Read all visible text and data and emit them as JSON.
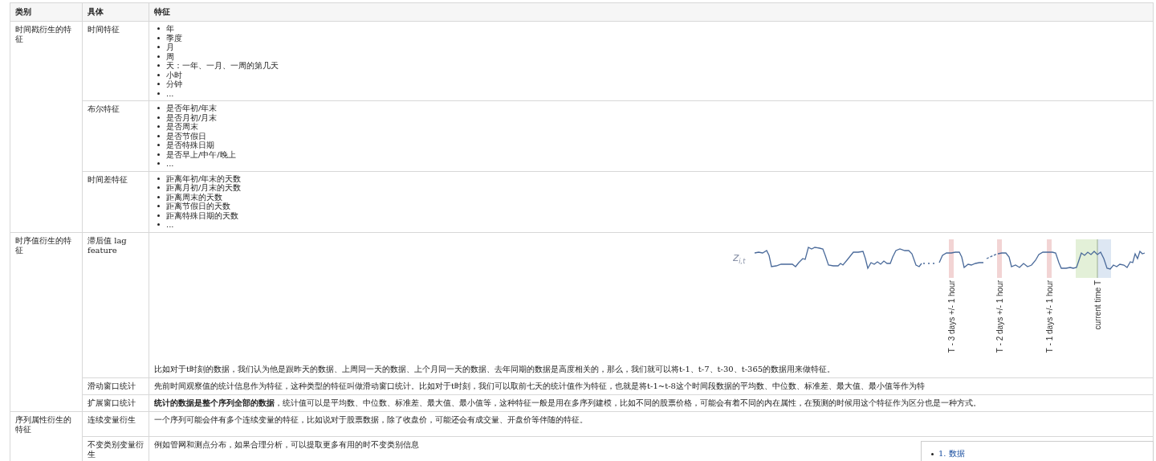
{
  "table": {
    "columns": [
      "类别",
      "具体",
      "特征"
    ],
    "groups": [
      {
        "category": "时间戳衍生的特征",
        "rows": [
          {
            "name": "时间特征",
            "kind": "list",
            "items": [
              "年",
              "季度",
              "月",
              "周",
              "天：一年、一月、一周的第几天",
              "小时",
              "分钟",
              "..."
            ]
          },
          {
            "name": "布尔特征",
            "kind": "list",
            "items": [
              "是否年初/年末",
              "是否月初/月末",
              "是否周末",
              "是否节假日",
              "是否特殊日期",
              "是否早上/中午/晚上",
              "..."
            ]
          },
          {
            "name": "时间差特征",
            "kind": "list",
            "items": [
              "距离年初/年末的天数",
              "距离月初/月末的天数",
              "距离周末的天数",
              "距离节假日的天数",
              "距离特殊日期的天数",
              "..."
            ]
          }
        ]
      },
      {
        "category": "时序值衍生的特征",
        "rows": [
          {
            "name": "滞后值 lag feature",
            "kind": "figure",
            "figure": {
              "symbol": "z",
              "subscript": "i,t",
              "markers": [
                {
                  "label": "T - 3 days +/- 1 hour",
                  "kind": "lag"
                },
                {
                  "label": "T - 2 days +/- 1 hour",
                  "kind": "lag"
                },
                {
                  "label": "T - 1 days +/- 1 hour",
                  "kind": "lag"
                },
                {
                  "label": "current time T",
                  "kind": "current"
                }
              ]
            },
            "text": "比如对于t时刻的数据，我们认为他是跟昨天的数据、上周同一天的数据、上个月同一天的数据、去年同期的数据是高度相关的，那么，我们就可以将t-1、t-7、t-30、t-365的数据用来做特征。"
          },
          {
            "name": "滑动窗口统计",
            "kind": "text",
            "text": "先前时间观察值的统计信息作为特征，这种类型的特征叫做滑动窗口统计。比如对于t时刻，我们可以取前七天的统计值作为特征，也就是将t-1~t-8这个时间段数据的平均数、中位数、标准差、最大值、最小值等作为特"
          },
          {
            "name": "扩展窗口统计",
            "kind": "text",
            "text": "**统计的数据是整个序列全部的数据**，统计值可以是平均数、中位数、标准差、最大值、最小值等，这种特征一般是用在多序列建模，比如不同的股票价格，可能会有着不同的内在属性，在预测的时候用这个特征作为区分也是一种方式。"
          }
        ]
      },
      {
        "category": "序列属性衍生的特征",
        "rows": [
          {
            "name": "连续变量衍生",
            "kind": "tall_text",
            "text": "一个序列可能会伴有多个连续变量的特征，比如说对于股票数据，除了收盘价，可能还会有成交量、开盘价等伴随的特征。"
          },
          {
            "name": "不变类别变量衍生",
            "kind": "text",
            "text": "例如管网和测点分布，如果合理分析，可以提取更多有用的时不变类别信息"
          }
        ]
      }
    ]
  },
  "toc": {
    "items": [
      {
        "number": "1.",
        "label": "数据"
      }
    ]
  }
}
